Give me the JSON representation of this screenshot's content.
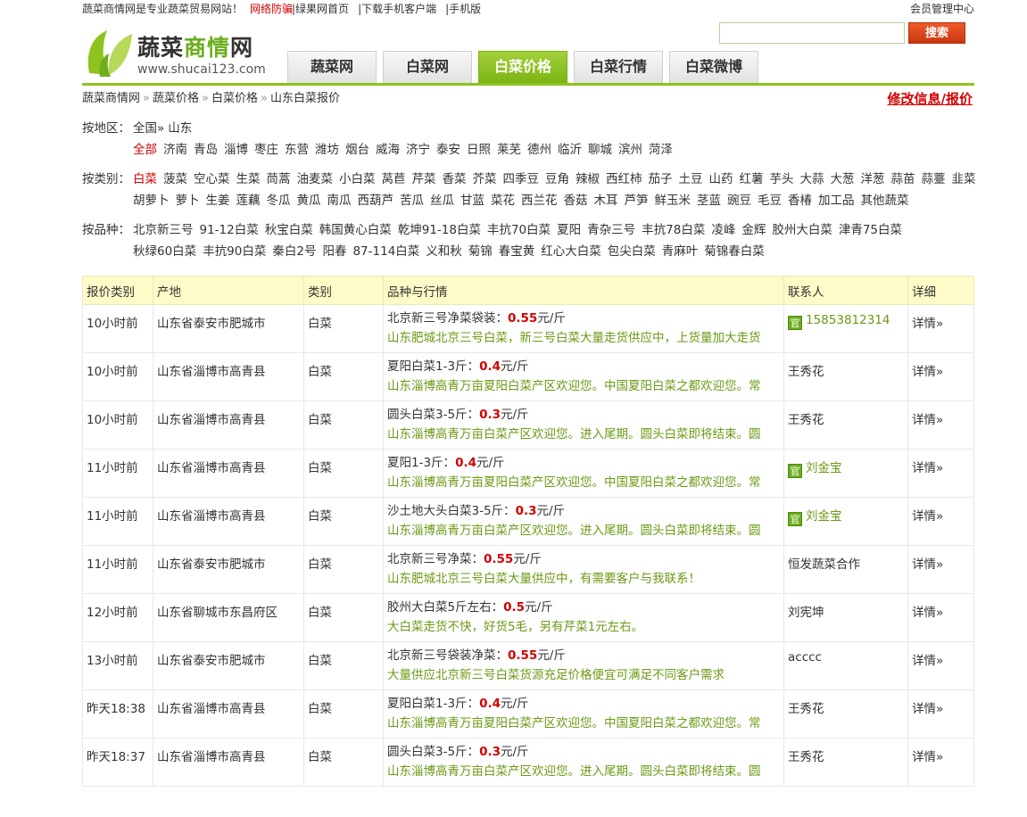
{
  "topbar": {
    "slogan": "蔬菜商情网是专业蔬菜贸易网站！",
    "warning": "网络防骗",
    "links": [
      "绿果网首页",
      "下载手机客户端",
      "手机版"
    ],
    "member": "会员管理中心"
  },
  "logo": {
    "name_a": "蔬菜",
    "name_b": "商情",
    "name_c": "网",
    "url": "www.shucai123.com"
  },
  "search": {
    "value": "",
    "button": "搜索"
  },
  "tabs": [
    {
      "label": "蔬菜网",
      "active": false
    },
    {
      "label": "白菜网",
      "active": false
    },
    {
      "label": "白菜价格",
      "active": true
    },
    {
      "label": "白菜行情",
      "active": false
    },
    {
      "label": "白菜微博",
      "active": false
    }
  ],
  "breadcrumb": {
    "items": [
      "蔬菜商情网",
      "蔬菜价格",
      "白菜价格",
      "山东白菜报价"
    ],
    "edit": "修改信息/报价"
  },
  "filters": {
    "region": {
      "label": "按地区：",
      "path": [
        "全国»",
        "山东"
      ],
      "items": [
        "全部",
        "济南",
        "青岛",
        "淄博",
        "枣庄",
        "东营",
        "潍坊",
        "烟台",
        "威海",
        "济宁",
        "泰安",
        "日照",
        "莱芜",
        "德州",
        "临沂",
        "聊城",
        "滨州",
        "菏泽"
      ],
      "selected": "全部"
    },
    "category": {
      "label": "按类别：",
      "items": [
        "白菜",
        "菠菜",
        "空心菜",
        "生菜",
        "茼蒿",
        "油麦菜",
        "小白菜",
        "莴苣",
        "芹菜",
        "香菜",
        "芥菜",
        "四季豆",
        "豆角",
        "辣椒",
        "西红柿",
        "茄子",
        "土豆",
        "山药",
        "红薯",
        "芋头",
        "大蒜",
        "大葱",
        "洋葱",
        "蒜苗",
        "蒜薹",
        "韭菜",
        "胡萝卜",
        "萝卜",
        "生姜",
        "莲藕",
        "冬瓜",
        "黄瓜",
        "南瓜",
        "西葫芦",
        "苦瓜",
        "丝瓜",
        "甘蓝",
        "菜花",
        "西兰花",
        "香菇",
        "木耳",
        "芦笋",
        "鲜玉米",
        "茎蓝",
        "豌豆",
        "毛豆",
        "香椿",
        "加工品",
        "其他蔬菜"
      ],
      "selected": "白菜"
    },
    "variety": {
      "label": "按品种：",
      "items": [
        "北京新三号",
        "91-12白菜",
        "秋宝白菜",
        "韩国黄心白菜",
        "乾坤91-18白菜",
        "丰抗70白菜",
        "夏阳",
        "青杂三号",
        "丰抗78白菜",
        "凌峰",
        "金辉",
        "胶州大白菜",
        "津青75白菜",
        "秋绿60白菜",
        "丰抗90白菜",
        "秦白2号",
        "阳春",
        "87-114白菜",
        "义和秋",
        "菊锦",
        "春宝黄",
        "红心大白菜",
        "包尖白菜",
        "青麻叶",
        "菊锦春白菜"
      ]
    }
  },
  "table": {
    "headers": [
      "报价类别",
      "产地",
      "类别",
      "品种与行情",
      "联系人",
      "详细"
    ],
    "rows": [
      {
        "time": "10小时前",
        "loc": "山东省泰安市肥城市",
        "cat": "白菜",
        "title": "北京新三号净菜袋装：",
        "price": "0.55",
        "unit": "元/斤",
        "desc": "山东肥城北京三号白菜，新三号白菜大量走货供应中，上货量加大走货",
        "contact": "15853812314",
        "official": true,
        "detail": "详情»"
      },
      {
        "time": "10小时前",
        "loc": "山东省淄博市高青县",
        "cat": "白菜",
        "title": "夏阳白菜1-3斤：",
        "price": "0.4",
        "unit": "元/斤",
        "desc": "山东淄博高青万亩夏阳白菜产区欢迎您。中国夏阳白菜之都欢迎您。常",
        "contact": "王秀花",
        "official": false,
        "detail": "详情»"
      },
      {
        "time": "10小时前",
        "loc": "山东省淄博市高青县",
        "cat": "白菜",
        "title": "圆头白菜3-5斤：",
        "price": "0.3",
        "unit": "元/斤",
        "desc": "山东淄博高青万亩白菜产区欢迎您。进入尾期。圆头白菜即将结束。圆",
        "contact": "王秀花",
        "official": false,
        "detail": "详情»"
      },
      {
        "time": "11小时前",
        "loc": "山东省淄博市高青县",
        "cat": "白菜",
        "title": "夏阳1-3斤：",
        "price": "0.4",
        "unit": "元/斤",
        "desc": "山东淄博高青万亩夏阳白菜产区欢迎您。中国夏阳白菜之都欢迎您。常",
        "contact": "刘金宝",
        "official": true,
        "detail": "详情»"
      },
      {
        "time": "11小时前",
        "loc": "山东省淄博市高青县",
        "cat": "白菜",
        "title": "沙土地大头白菜3-5斤：",
        "price": "0.3",
        "unit": "元/斤",
        "desc": "山东淄博高青万亩白菜产区欢迎您。进入尾期。圆头白菜即将结束。圆",
        "contact": "刘金宝",
        "official": true,
        "detail": "详情»"
      },
      {
        "time": "11小时前",
        "loc": "山东省泰安市肥城市",
        "cat": "白菜",
        "title": "北京新三号净菜：",
        "price": "0.55",
        "unit": "元/斤",
        "desc": "山东肥城北京三号白菜大量供应中，有需要客户与我联系！",
        "contact": "恒发蔬菜合作",
        "official": false,
        "detail": "详情»"
      },
      {
        "time": "12小时前",
        "loc": "山东省聊城市东昌府区",
        "cat": "白菜",
        "title": "胶州大白菜5斤左右：",
        "price": "0.5",
        "unit": "元/斤",
        "desc": "大白菜走货不快，好货5毛，另有芹菜1元左右。",
        "contact": "刘宪坤",
        "official": false,
        "detail": "详情»"
      },
      {
        "time": "13小时前",
        "loc": "山东省泰安市肥城市",
        "cat": "白菜",
        "title": "北京新三号袋装净菜：",
        "price": "0.55",
        "unit": "元/斤",
        "desc": "大量供应北京新三号白菜货源充足价格便宜可满足不同客户需求",
        "contact": "acccc",
        "official": false,
        "detail": "详情»"
      },
      {
        "time": "昨天18:38",
        "loc": "山东省淄博市高青县",
        "cat": "白菜",
        "title": "夏阳白菜1-3斤：",
        "price": "0.4",
        "unit": "元/斤",
        "desc": "山东淄博高青万亩夏阳白菜产区欢迎您。中国夏阳白菜之都欢迎您。常",
        "contact": "王秀花",
        "official": false,
        "detail": "详情»"
      },
      {
        "time": "昨天18:37",
        "loc": "山东省淄博市高青县",
        "cat": "白菜",
        "title": "圆头白菜3-5斤：",
        "price": "0.3",
        "unit": "元/斤",
        "desc": "山东淄博高青万亩白菜产区欢迎您。进入尾期。圆头白菜即将结束。圆",
        "contact": "王秀花",
        "official": false,
        "detail": "详情»"
      }
    ],
    "official_badge": "官"
  }
}
